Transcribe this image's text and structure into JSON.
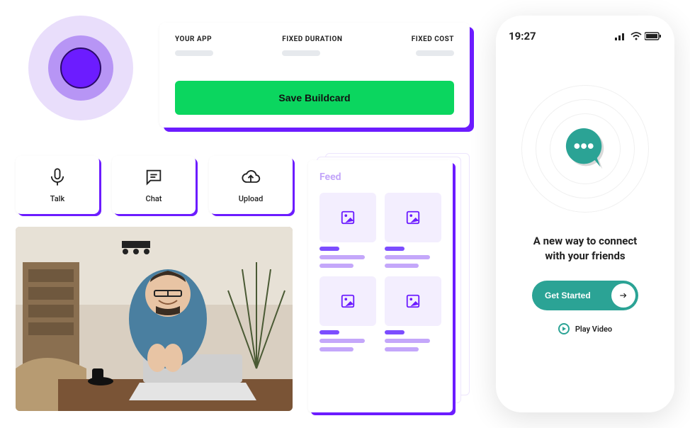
{
  "buildcard": {
    "col1": "YOUR APP",
    "col2": "FIXED DURATION",
    "col3": "FIXED COST",
    "save_label": "Save Buildcard"
  },
  "actions": {
    "talk": "Talk",
    "chat": "Chat",
    "upload": "Upload"
  },
  "feed": {
    "title": "Feed"
  },
  "phone": {
    "time": "19:27",
    "headline_line1": "A new way to connect",
    "headline_line2": "with your friends",
    "get_started": "Get Started",
    "play_video": "Play Video"
  }
}
